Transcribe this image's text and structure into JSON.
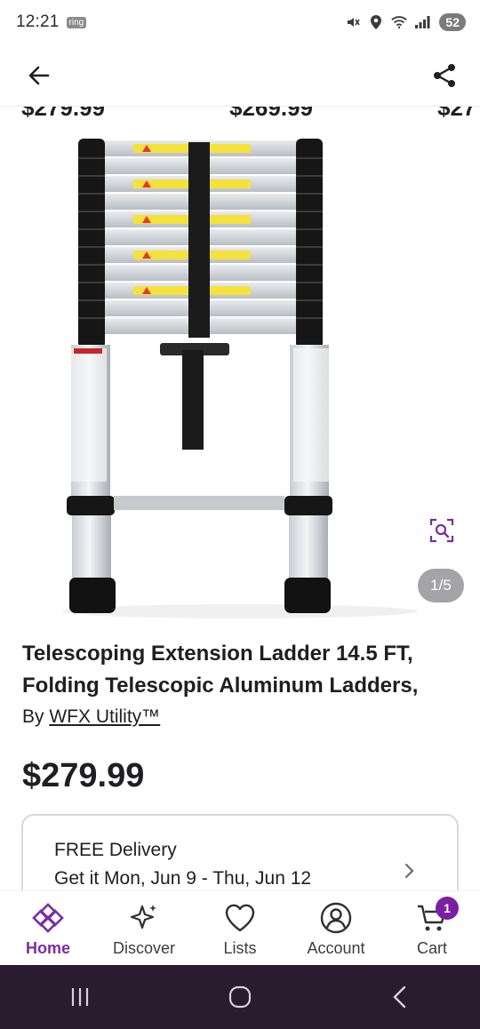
{
  "status_bar": {
    "time": "12:21",
    "chip": "ring",
    "battery": "52"
  },
  "header": {
    "back_icon": "arrow-left-icon",
    "share_icon": "share-icon"
  },
  "carousel_peek": {
    "prices": [
      "$279.99",
      "$269.99",
      "$27"
    ]
  },
  "product": {
    "image_counter": "1/5",
    "title": "Telescoping Extension Ladder 14.5 FT, Folding Telescopic Aluminum Ladders,",
    "brand_prefix": "By",
    "brand": "WFX Utility™",
    "price": "$279.99"
  },
  "delivery": {
    "title": "FREE Delivery",
    "date": "Get it Mon, Jun 9 - Thu, Jun 12"
  },
  "bottom_nav": {
    "items": [
      {
        "label": "Home",
        "icon": "home-icon",
        "active": true
      },
      {
        "label": "Discover",
        "icon": "sparkle-icon",
        "active": false
      },
      {
        "label": "Lists",
        "icon": "heart-icon",
        "active": false
      },
      {
        "label": "Account",
        "icon": "user-icon",
        "active": false
      },
      {
        "label": "Cart",
        "icon": "cart-icon",
        "active": false
      }
    ],
    "cart_count": "1"
  },
  "colors": {
    "accent": "#7b2d9e",
    "badge": "#7b1fa2",
    "system_nav": "#2a1b2e"
  }
}
